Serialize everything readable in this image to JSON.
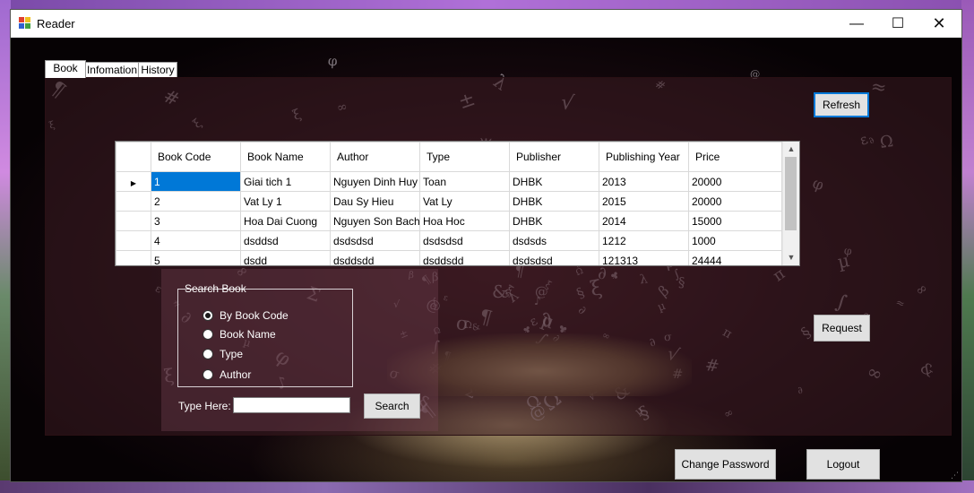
{
  "window": {
    "title": "Reader",
    "minimize_glyph": "—",
    "maximize_glyph": "☐",
    "close_glyph": "✕"
  },
  "tabs": [
    {
      "label": "Book",
      "active": true
    },
    {
      "label": "Infomation",
      "active": false
    },
    {
      "label": "History",
      "active": false
    }
  ],
  "buttons": {
    "refresh": "Refresh",
    "request": "Request",
    "search": "Search",
    "change_password": "Change Password",
    "logout": "Logout"
  },
  "books_table": {
    "columns": [
      "Book Code",
      "Book Name",
      "Author",
      "Type",
      "Publisher",
      "Publishing Year",
      "Price"
    ],
    "rows": [
      [
        "1",
        "Giai tich 1",
        "Nguyen Dinh Huy",
        "Toan",
        "DHBK",
        "2013",
        "20000"
      ],
      [
        "2",
        "Vat Ly 1",
        "Dau Sy Hieu",
        "Vat Ly",
        "DHBK",
        "2015",
        "20000"
      ],
      [
        "3",
        "Hoa Dai Cuong",
        "Nguyen Son Bach",
        "Hoa Hoc",
        "DHBK",
        "2014",
        "15000"
      ],
      [
        "4",
        "dsddsd",
        "dsdsdsd",
        "dsdsdsd",
        "dsdsds",
        "1212",
        "1000"
      ],
      [
        "5",
        "dsdd",
        "dsddsdd",
        "dsddsdd",
        "dsdsdsd",
        "121313",
        "24444"
      ]
    ],
    "current_row_marker": "▶"
  },
  "search_book": {
    "title": "Search Book",
    "options": [
      {
        "label": "By Book Code",
        "checked": true
      },
      {
        "label": "Book Name",
        "checked": false
      },
      {
        "label": "Type",
        "checked": false
      },
      {
        "label": "Author",
        "checked": false
      }
    ],
    "type_here_label": "Type Here:",
    "input_value": ""
  }
}
